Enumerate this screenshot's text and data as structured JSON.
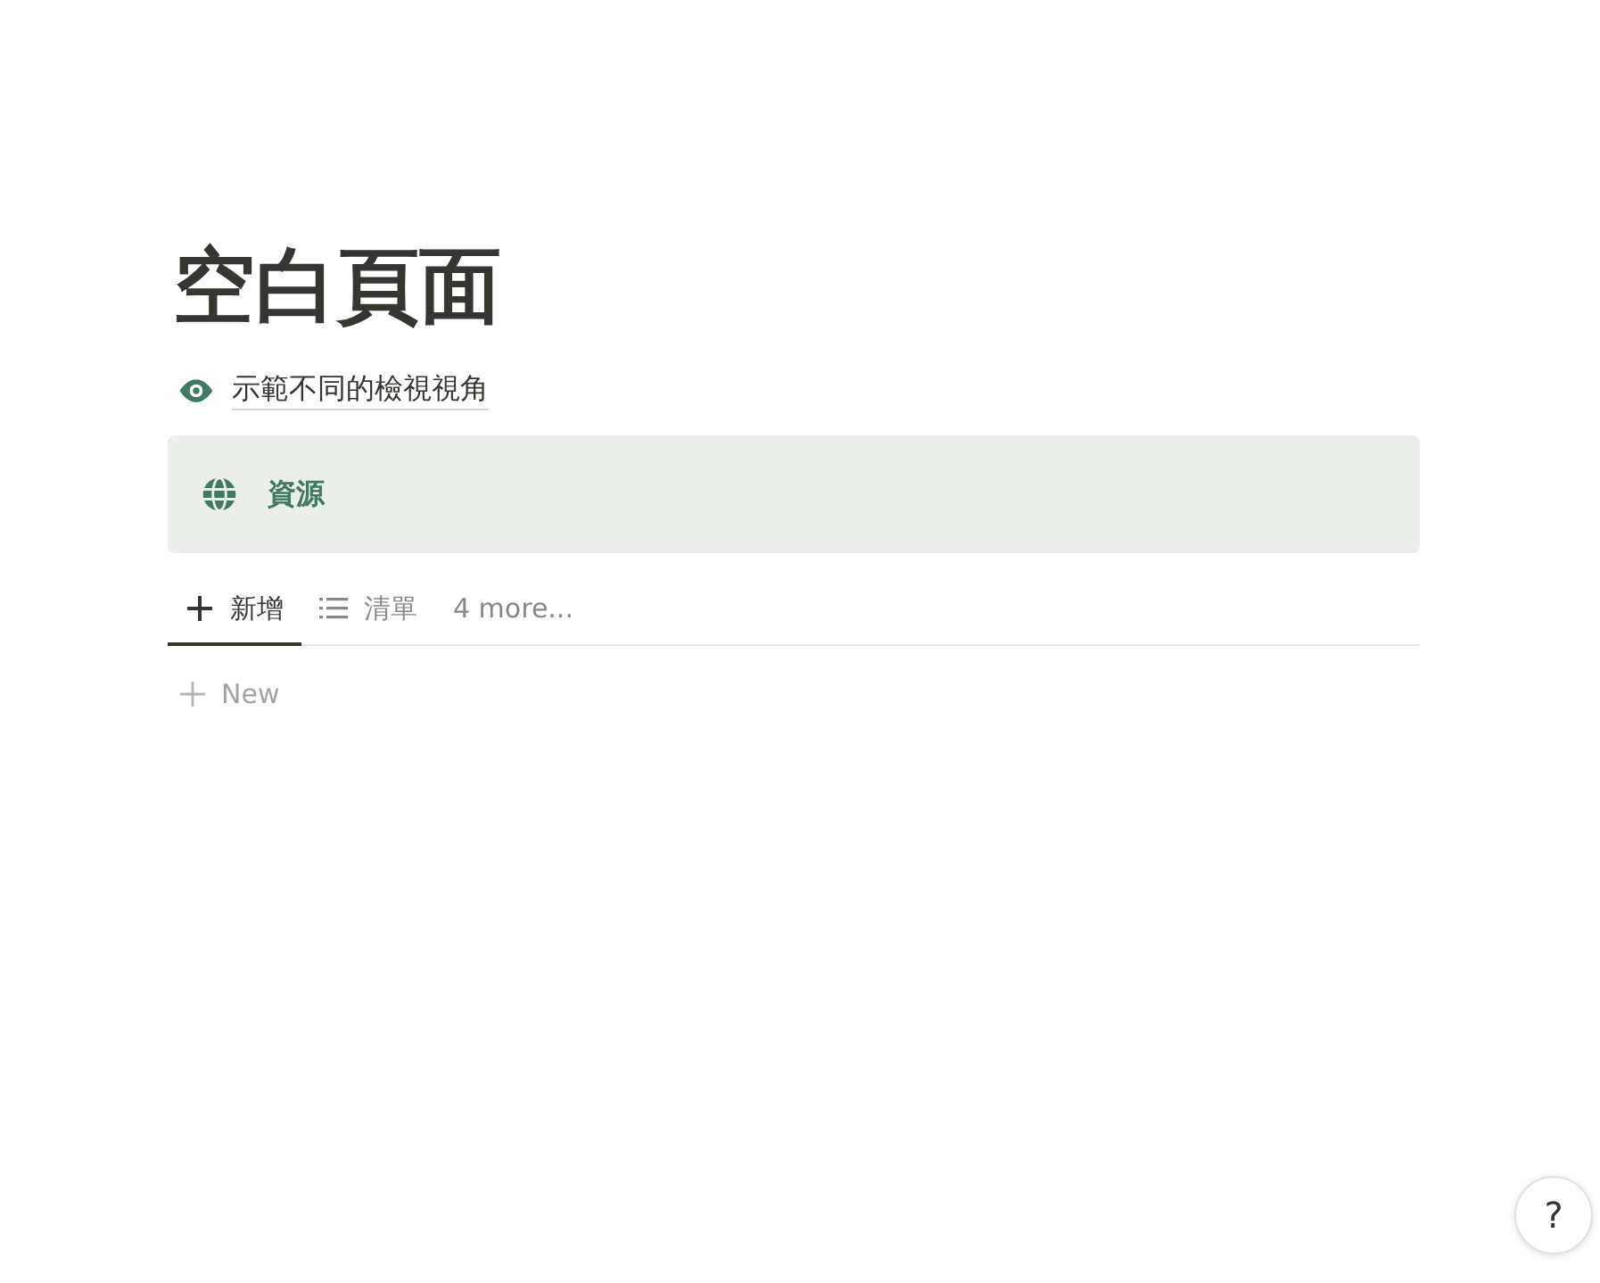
{
  "page": {
    "title": "空白頁面",
    "subtitle_link": "示範不同的檢視視角"
  },
  "callout": {
    "text": "資源"
  },
  "tabs": [
    {
      "label": "新增",
      "kind": "plus",
      "selected": true
    },
    {
      "label": "清單",
      "kind": "list",
      "selected": false
    }
  ],
  "more_views": "4 more...",
  "new_row": "New",
  "help_button": "?"
}
